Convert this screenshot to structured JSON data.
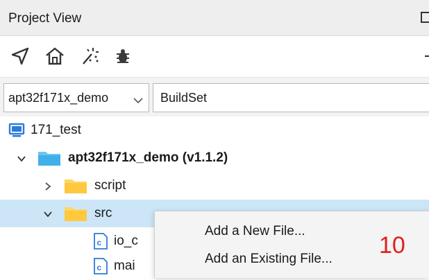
{
  "panel": {
    "title": "Project View"
  },
  "toolbar": {
    "icons": [
      "locate-icon",
      "home-icon",
      "magic-wand-icon",
      "bug-icon"
    ]
  },
  "config": {
    "project_select": "apt32f171x_demo",
    "buildset_label": "BuildSet"
  },
  "tree": {
    "workspace": "171_test",
    "project": "apt32f171x_demo (v1.1.2)",
    "folders": [
      "script",
      "src"
    ],
    "files": [
      "io_c",
      "mai"
    ]
  },
  "context_menu": {
    "items": [
      "Add a New File...",
      "Add an Existing File..."
    ]
  },
  "annotation": {
    "label": "10",
    "color": "#e0201b"
  },
  "colors": {
    "selection": "#cce6f7",
    "folder": "#ffc83d",
    "workspace_icon": "#2b7bd8"
  }
}
